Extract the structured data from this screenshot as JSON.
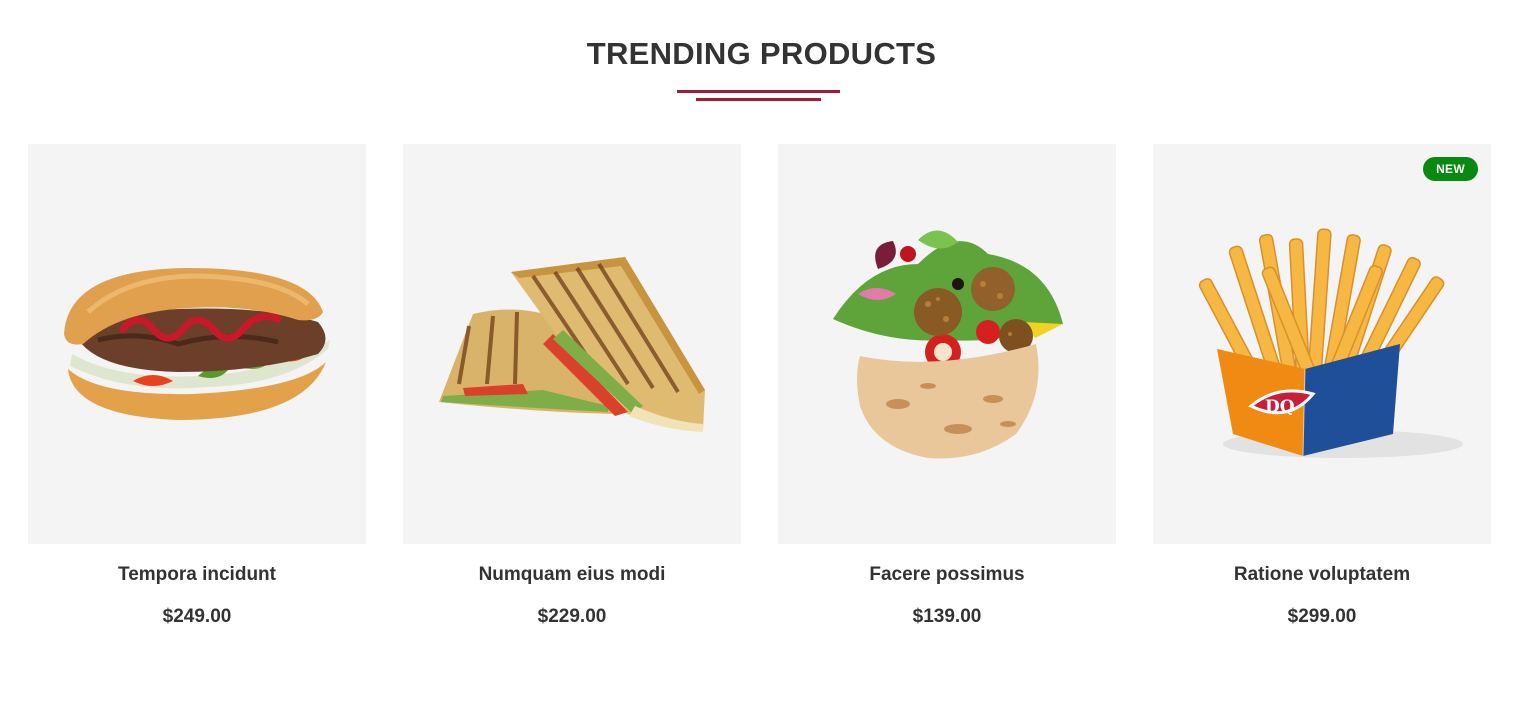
{
  "section": {
    "title": "TRENDING PRODUCTS"
  },
  "products": [
    {
      "name": "Tempora incidunt",
      "price": "$249.00",
      "image": "kebab-sandwich-icon",
      "badge": ""
    },
    {
      "name": "Numquam eius modi",
      "price": "$229.00",
      "image": "grilled-sandwich-icon",
      "badge": ""
    },
    {
      "name": "Facere possimus",
      "price": "$139.00",
      "image": "falafel-pita-icon",
      "badge": ""
    },
    {
      "name": "Ratione voluptatem",
      "price": "$299.00",
      "image": "french-fries-icon",
      "badge": "NEW",
      "brand_mark": "DQ"
    }
  ],
  "colors": {
    "accent": "#a31a3a",
    "badge": "#078a0f",
    "card_bg": "#f4f4f4",
    "text": "#333333"
  }
}
